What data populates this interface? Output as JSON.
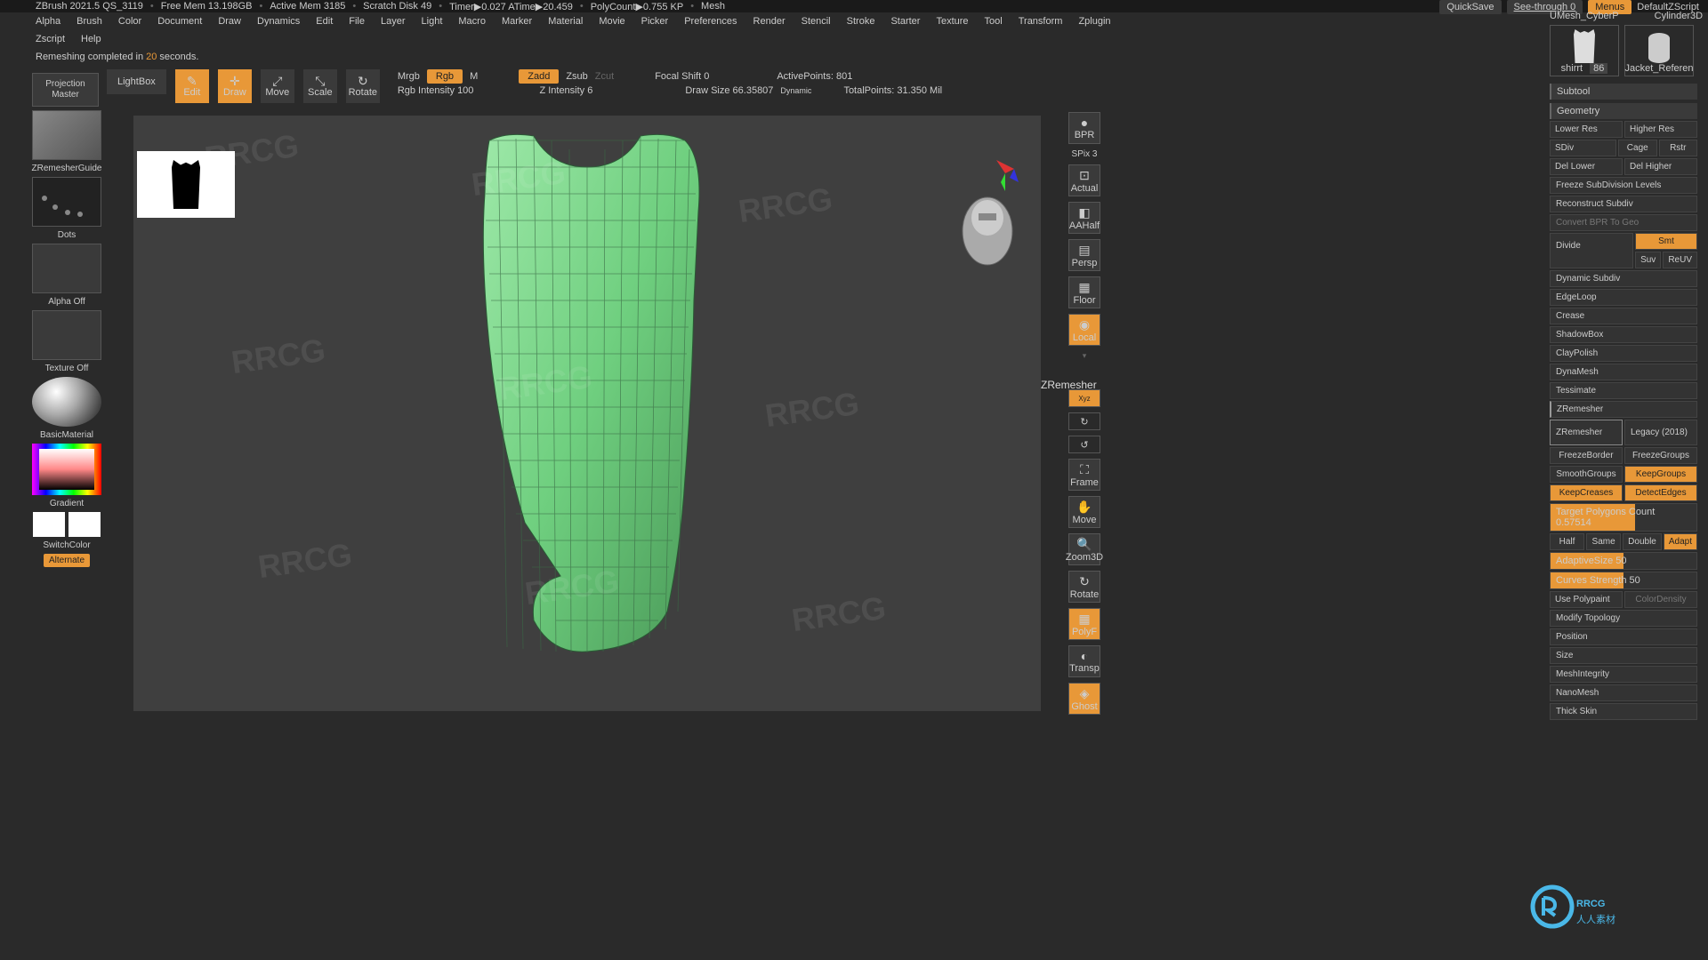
{
  "title": {
    "app": "ZBrush 2021.5 QS_3119",
    "freemem": "Free Mem 13.198GB",
    "activemem": "Active Mem 3185",
    "scratch": "Scratch Disk 49",
    "timer": "Timer▶0.027 ATime▶20.459",
    "polycount": "PolyCount▶0.755 KP",
    "mesh": "Mesh"
  },
  "topright": {
    "quicksave": "QuickSave",
    "seethrough": "See-through 0",
    "menus": "Menus",
    "defaultscript": "DefaultZScript"
  },
  "menu": [
    "Alpha",
    "Brush",
    "Color",
    "Document",
    "Draw",
    "Dynamics",
    "Edit",
    "File",
    "Layer",
    "Light",
    "Macro",
    "Marker",
    "Material",
    "Movie",
    "Picker",
    "Preferences",
    "Render",
    "Stencil",
    "Stroke",
    "Starter",
    "Texture",
    "Tool",
    "Transform",
    "Zplugin"
  ],
  "menu2": [
    "Zscript",
    "Help"
  ],
  "status": {
    "prefix": "Remeshing completed in ",
    "num": "20",
    "suffix": " seconds."
  },
  "projmaster": "Projection Master",
  "lightbox": "LightBox",
  "tb": {
    "edit": "Edit",
    "draw": "Draw",
    "move": "Move",
    "scale": "Scale",
    "rotate": "Rotate",
    "mrgb": "Mrgb",
    "rgb": "Rgb",
    "m": "M",
    "rgbint": "Rgb Intensity 100",
    "zadd": "Zadd",
    "zsub": "Zsub",
    "zcut": "Zcut",
    "zint": "Z Intensity 6",
    "focal": "Focal Shift 0",
    "drawsize": "Draw Size 66.35807",
    "dynamic": "Dynamic",
    "active": "ActivePoints: 801",
    "total": "TotalPoints: 31.350 Mil"
  },
  "lp": {
    "zremesher": "ZRemesherGuide",
    "dots": "Dots",
    "alpha": "Alpha Off",
    "texture": "Texture Off",
    "material": "BasicMaterial",
    "gradient": "Gradient",
    "switchcolor": "SwitchColor",
    "alternate": "Alternate"
  },
  "rt": {
    "bpr": "BPR",
    "spix": "SPix 3",
    "actual": "Actual",
    "aahalf": "AAHalf",
    "persp": "Persp",
    "floor": "Floor",
    "local": "Local",
    "xyz": "Xyz",
    "frame": "Frame",
    "move": "Move",
    "zoom": "Zoom3D",
    "rotate": "Rotate",
    "polyf": "PolyF",
    "transp": "Transp",
    "ghost": "Ghost",
    "zremesher": "ZRemesher"
  },
  "rp": {
    "tools": {
      "t1": "shirrt",
      "t1n": "86",
      "t2": "Jacket_Referen",
      "umesh": "UMesh_CyberP",
      "cyl": "Cylinder3D"
    },
    "subtool": "Subtool",
    "geometry": "Geometry",
    "lowerres": "Lower Res",
    "higherres": "Higher Res",
    "sdiv": "SDiv",
    "cage": "Cage",
    "rstr": "Rstr",
    "dellower": "Del Lower",
    "delhigher": "Del Higher",
    "freeze": "Freeze SubDivision Levels",
    "reconstruct": "Reconstruct Subdiv",
    "convert": "Convert BPR To Geo",
    "divide": "Divide",
    "smt": "Smt",
    "suv": "Suv",
    "reuv": "ReUV",
    "dynamicsub": "Dynamic Subdiv",
    "edgeloop": "EdgeLoop",
    "crease": "Crease",
    "shadowbox": "ShadowBox",
    "claypolish": "ClayPolish",
    "dynamesh": "DynaMesh",
    "tessimate": "Tessimate",
    "zremesher": "ZRemesher",
    "zremesherbtn": "ZRemesher",
    "legacy": "Legacy (2018)",
    "freezeborder": "FreezeBorder",
    "freezegroups": "FreezeGroups",
    "smoothgroups": "SmoothGroups",
    "keepgroups": "KeepGroups",
    "keepcreases": "KeepCreases",
    "detectedges": "DetectEdges",
    "target": "Target Polygons Count 0.57514",
    "half": "Half",
    "same": "Same",
    "double": "Double",
    "adapt": "Adapt",
    "adaptivesize": "AdaptiveSize 50",
    "curvesstrength": "Curves Strength 50",
    "usepolypaint": "Use Polypaint",
    "colordensity": "ColorDensity",
    "modifytopo": "Modify Topology",
    "position": "Position",
    "size": "Size",
    "meshintegrity": "MeshIntegrity",
    "nanomesh": "NanoMesh",
    "thickskin": "Thick Skin"
  },
  "watermark": "RRCG"
}
